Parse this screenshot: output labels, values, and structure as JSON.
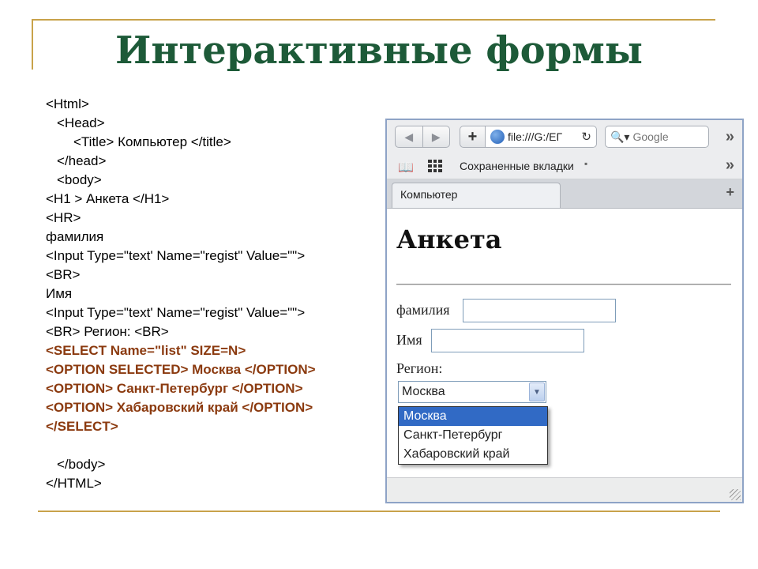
{
  "slide": {
    "title": "Интерактивные формы",
    "code_lines": [
      {
        "text": "<Html>",
        "indent": 0,
        "highlight": false
      },
      {
        "text": "<Head>",
        "indent": 2,
        "highlight": false
      },
      {
        "text": "<Title> Компьютер </title>",
        "indent": 5,
        "highlight": false
      },
      {
        "text": "</head>",
        "indent": 2,
        "highlight": false
      },
      {
        "text": "<body>",
        "indent": 2,
        "highlight": false
      },
      {
        "text": "<H1 > Анкета </H1>",
        "indent": 0,
        "highlight": false
      },
      {
        "text": "<HR>",
        "indent": 0,
        "highlight": false
      },
      {
        "text": "фамилия",
        "indent": 0,
        "highlight": false
      },
      {
        "text": "<Input Type=\"text' Name=\"regist\" Value=\"\">",
        "indent": 0,
        "highlight": false
      },
      {
        "text": "<BR>",
        "indent": 0,
        "highlight": false
      },
      {
        "text": "Имя",
        "indent": 0,
        "highlight": false
      },
      {
        "text": "<Input Type=\"text' Name=\"regist\" Value=\"\">",
        "indent": 0,
        "highlight": false
      },
      {
        "text": "<BR> Регион: <BR>",
        "indent": 0,
        "highlight": false
      },
      {
        "text": "<SELECT Name=\"list\" SIZE=N>",
        "indent": 0,
        "highlight": true
      },
      {
        "text": "<OPTION SELECTED> Москва </OPTION>",
        "indent": 0,
        "highlight": true
      },
      {
        "text": "<OPTION> Санкт-Петербург </OPTION>",
        "indent": 0,
        "highlight": true
      },
      {
        "text": "<OPTION> Хабаровский край </OPTION>",
        "indent": 0,
        "highlight": true
      },
      {
        "text": "</SELECT>",
        "indent": 0,
        "highlight": true
      },
      {
        "text": "",
        "indent": 0,
        "highlight": false
      },
      {
        "text": "</body>",
        "indent": 2,
        "highlight": false
      },
      {
        "text": "</HTML>",
        "indent": 0,
        "highlight": false
      }
    ],
    "colors": {
      "title": "#1d5a38",
      "highlight": "#8b3a0f",
      "rule": "#c8a24a"
    }
  },
  "browser": {
    "toolbar": {
      "back_icon": "back-arrow-icon",
      "forward_icon": "forward-arrow-icon",
      "add_icon": "plus-icon",
      "url": "file:///G:/ЕГ",
      "reload_icon": "reload-icon",
      "search_placeholder": "Google",
      "search_icon": "search-icon",
      "overflow_icon": "chevron-double-right-icon"
    },
    "bookmarks": {
      "label": "Сохраненные вкладки",
      "book_icon": "book-icon",
      "grid_icon": "grid-icon"
    },
    "tab": {
      "title": "Компьютер",
      "new_tab_icon": "plus-icon"
    },
    "page": {
      "heading": "Анкета",
      "fields": [
        {
          "label": "фамилия",
          "value": ""
        },
        {
          "label": "Имя",
          "value": ""
        }
      ],
      "region_label": "Регион:",
      "select": {
        "selected": "Москва",
        "options": [
          "Москва",
          "Санкт-Петербург",
          "Хабаровский край"
        ]
      }
    }
  }
}
